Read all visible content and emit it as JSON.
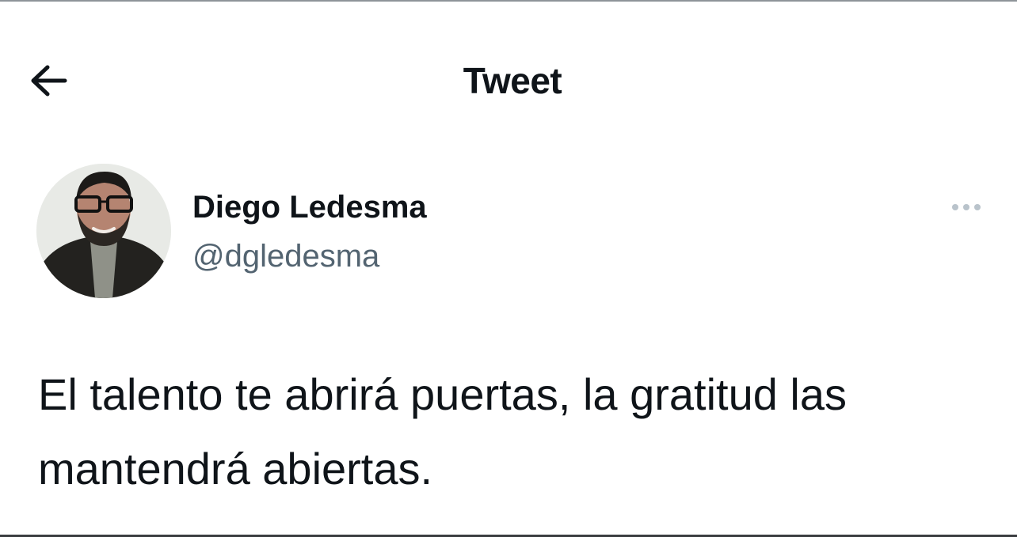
{
  "header": {
    "title": "Tweet",
    "back_icon": "arrow-left-icon"
  },
  "tweet": {
    "author": {
      "display_name": "Diego Ledesma",
      "handle": "@dgledesma",
      "avatar_alt": "Diego Ledesma"
    },
    "more_icon": "more-horizontal-icon",
    "text": "El talento te abrirá puertas, la gratitud las mantendrá abiertas."
  },
  "colors": {
    "text_primary": "#0f1419",
    "text_secondary": "#536471",
    "more_dots": "#b9c3cb",
    "background": "#ffffff"
  }
}
